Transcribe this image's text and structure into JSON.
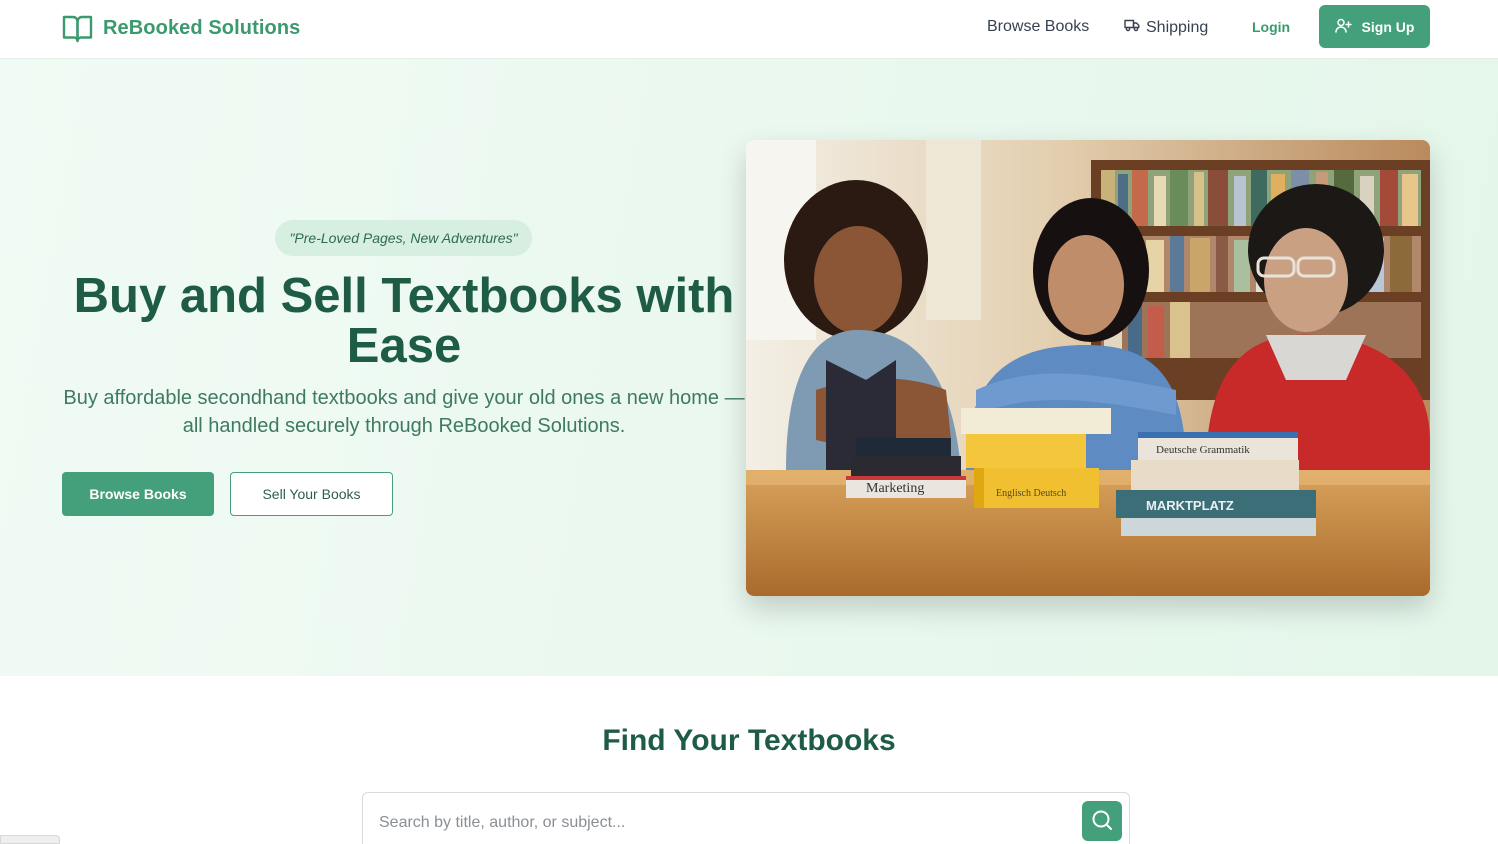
{
  "brand": {
    "name": "ReBooked Solutions",
    "icon": "open-book-icon",
    "color": "#3a9a6d"
  },
  "nav": {
    "browse_label": "Browse Books",
    "shipping_label": "Shipping",
    "shipping_icon": "truck-icon",
    "login_label": "Login",
    "signup_label": "Sign Up",
    "signup_icon": "user-plus-icon"
  },
  "hero": {
    "tagline": "\"Pre-Loved Pages, New Adventures\"",
    "title": "Buy and Sell Textbooks with Ease",
    "subtitle": "Buy affordable secondhand textbooks and give your old ones a new home — all handled securely through ReBooked Solutions.",
    "primary_button": "Browse Books",
    "secondary_button": "Sell Your Books",
    "book_spines": [
      "Marketing",
      "MARKTPLATZ",
      "Deutsche Grammatik",
      "Englisch Deutsch"
    ]
  },
  "search": {
    "title": "Find Your Textbooks",
    "placeholder": "Search by title, author, or subject...",
    "button_icon": "search-icon"
  },
  "colors": {
    "accent": "#44a07a",
    "heading": "#1e5c45",
    "hero_background": "#eaf8ef"
  }
}
